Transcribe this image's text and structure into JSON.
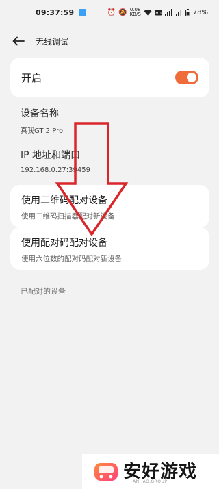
{
  "status_bar": {
    "time": "09:37:59",
    "net_speed_value": "0.08",
    "net_speed_unit": "KB/S",
    "battery": "78%"
  },
  "header": {
    "title": "无线调试"
  },
  "toggle": {
    "label": "开启",
    "enabled": true
  },
  "device": {
    "label": "设备名称",
    "value": "真我GT 2 Pro"
  },
  "ip": {
    "label": "IP 地址和端口",
    "value": "192.168.0.27:39459"
  },
  "pair_qr": {
    "title": "使用二维码配对设备",
    "subtitle": "使用二维码扫描器配对新设备"
  },
  "pair_code": {
    "title": "使用配对码配对设备",
    "subtitle": "使用六位数的配对码配对新设备"
  },
  "paired": {
    "label": "已配对的设备"
  },
  "watermark": {
    "brand": "安好游戏",
    "domain": "ANHAO.GROUP"
  },
  "colors": {
    "accent": "#ef6b3a",
    "arrow": "#d9262a",
    "background": "#f2f2f2",
    "card": "#ffffff"
  }
}
